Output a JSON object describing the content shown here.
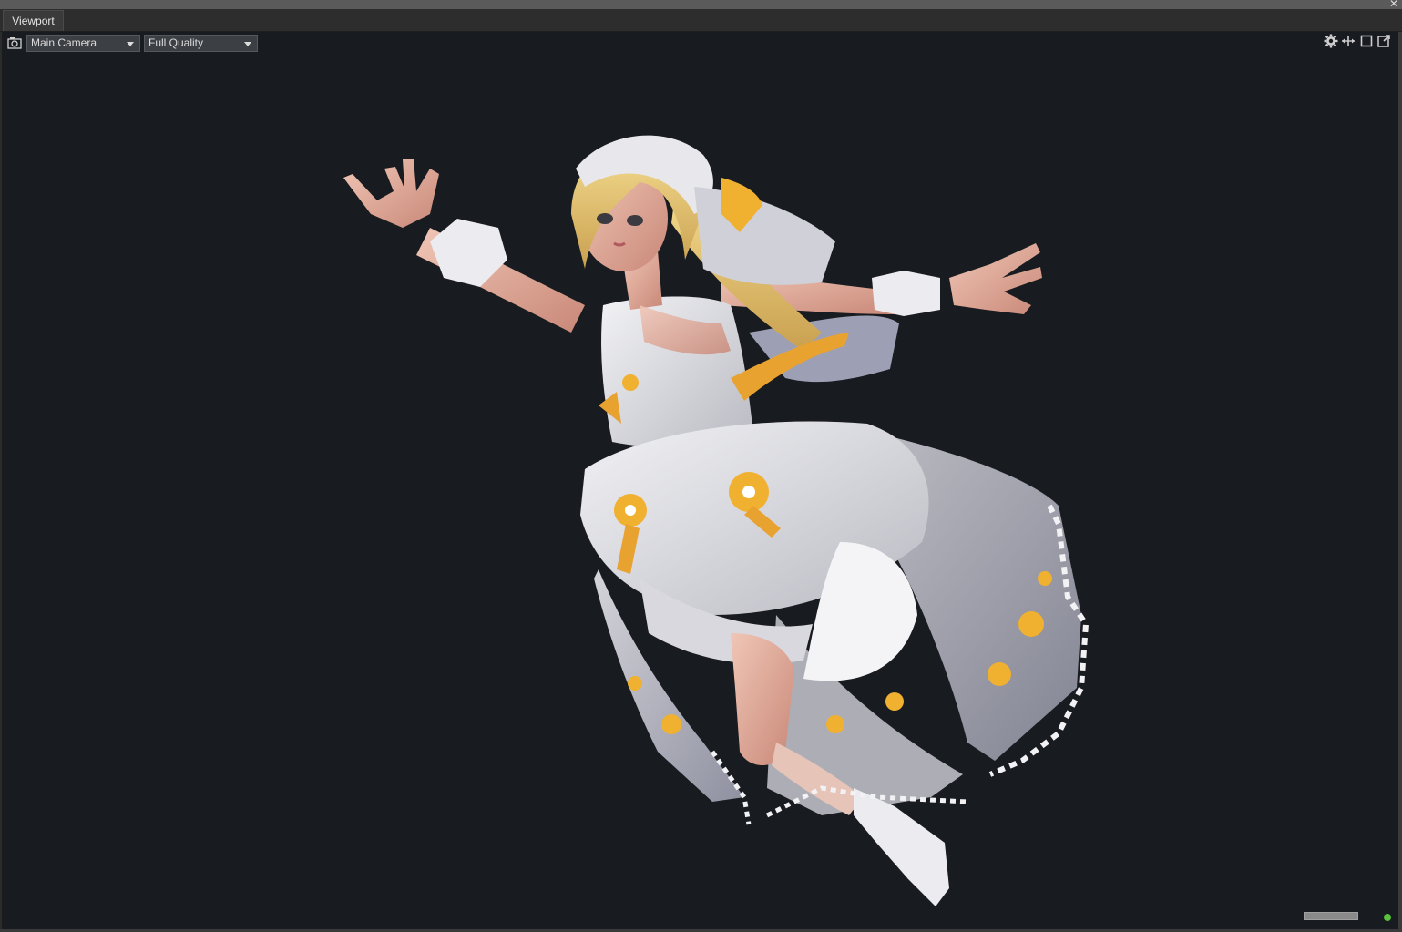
{
  "window": {
    "close_glyph": "✕"
  },
  "tabs": [
    {
      "label": "Viewport",
      "active": true
    }
  ],
  "toolbar": {
    "camera_icon": "camera-icon",
    "camera_select": {
      "value": "Main Camera"
    },
    "quality_select": {
      "value": "Full Quality"
    },
    "right_icons": [
      "gear-icon",
      "move-arrows-icon",
      "maximize-square-icon",
      "popout-icon"
    ]
  },
  "status": {
    "indicator_color": "#58c43a"
  },
  "colors": {
    "viewport_bg": "#181b20",
    "dress": "#e4e4e8",
    "hair": "#e8c070",
    "flower": "#f0b030",
    "skin": "#e6b0a0"
  }
}
